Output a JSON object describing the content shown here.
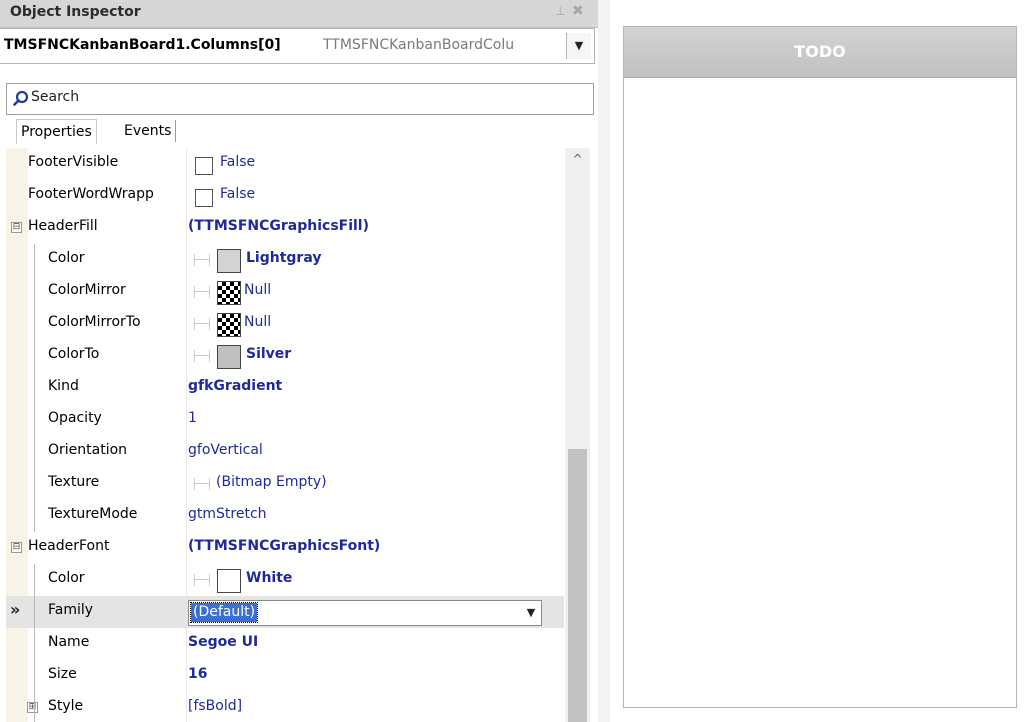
{
  "inspector": {
    "title": "Object Inspector",
    "pin_glyph": "⊥",
    "close_glyph": "✖",
    "selector": {
      "object_name": "TMSFNCKanbanBoard1.Columns[0]",
      "object_type": "TTMSFNCKanbanBoardColu"
    },
    "search": {
      "icon": "search-icon",
      "text": "Search"
    },
    "tabs": [
      {
        "label": "Properties"
      },
      {
        "label": "Events"
      }
    ],
    "properties": {
      "footer_visible": {
        "name": "FooterVisible",
        "value": "False"
      },
      "footer_word_wrap": {
        "name": "FooterWordWrapp",
        "value": "False"
      },
      "header_fill": {
        "name": "HeaderFill",
        "value": "(TTMSFNCGraphicsFill)",
        "expander": "⊟"
      },
      "fill_color": {
        "name": "Color",
        "value": "Lightgray",
        "swatch": "#d3d3d3"
      },
      "fill_color_mirror": {
        "name": "ColorMirror",
        "value": "Null"
      },
      "fill_color_mirror_to": {
        "name": "ColorMirrorTo",
        "value": "Null"
      },
      "fill_color_to": {
        "name": "ColorTo",
        "value": "Silver",
        "swatch": "#c0c0c0"
      },
      "fill_kind": {
        "name": "Kind",
        "value": "gfkGradient"
      },
      "fill_opacity": {
        "name": "Opacity",
        "value": "1"
      },
      "fill_orientation": {
        "name": "Orientation",
        "value": "gfoVertical"
      },
      "fill_texture": {
        "name": "Texture",
        "value": "(Bitmap Empty)"
      },
      "fill_texture_mode": {
        "name": "TextureMode",
        "value": "gtmStretch"
      },
      "header_font": {
        "name": "HeaderFont",
        "value": "(TTMSFNCGraphicsFont)",
        "expander": "⊟"
      },
      "font_color": {
        "name": "Color",
        "value": "White",
        "swatch": "#ffffff"
      },
      "font_family": {
        "name": "Family",
        "value": "(Default)",
        "marker": "»"
      },
      "font_name": {
        "name": "Name",
        "value": "Segoe UI"
      },
      "font_size": {
        "name": "Size",
        "value": "16"
      },
      "font_style": {
        "name": "Style",
        "value": "[fsBold]",
        "expander": "⊞"
      }
    }
  },
  "kanban": {
    "column_title": "TODO",
    "header_gradient_from": "#d3d3d3",
    "header_gradient_to": "#c0c0c0",
    "header_font_color": "#ffffff"
  }
}
